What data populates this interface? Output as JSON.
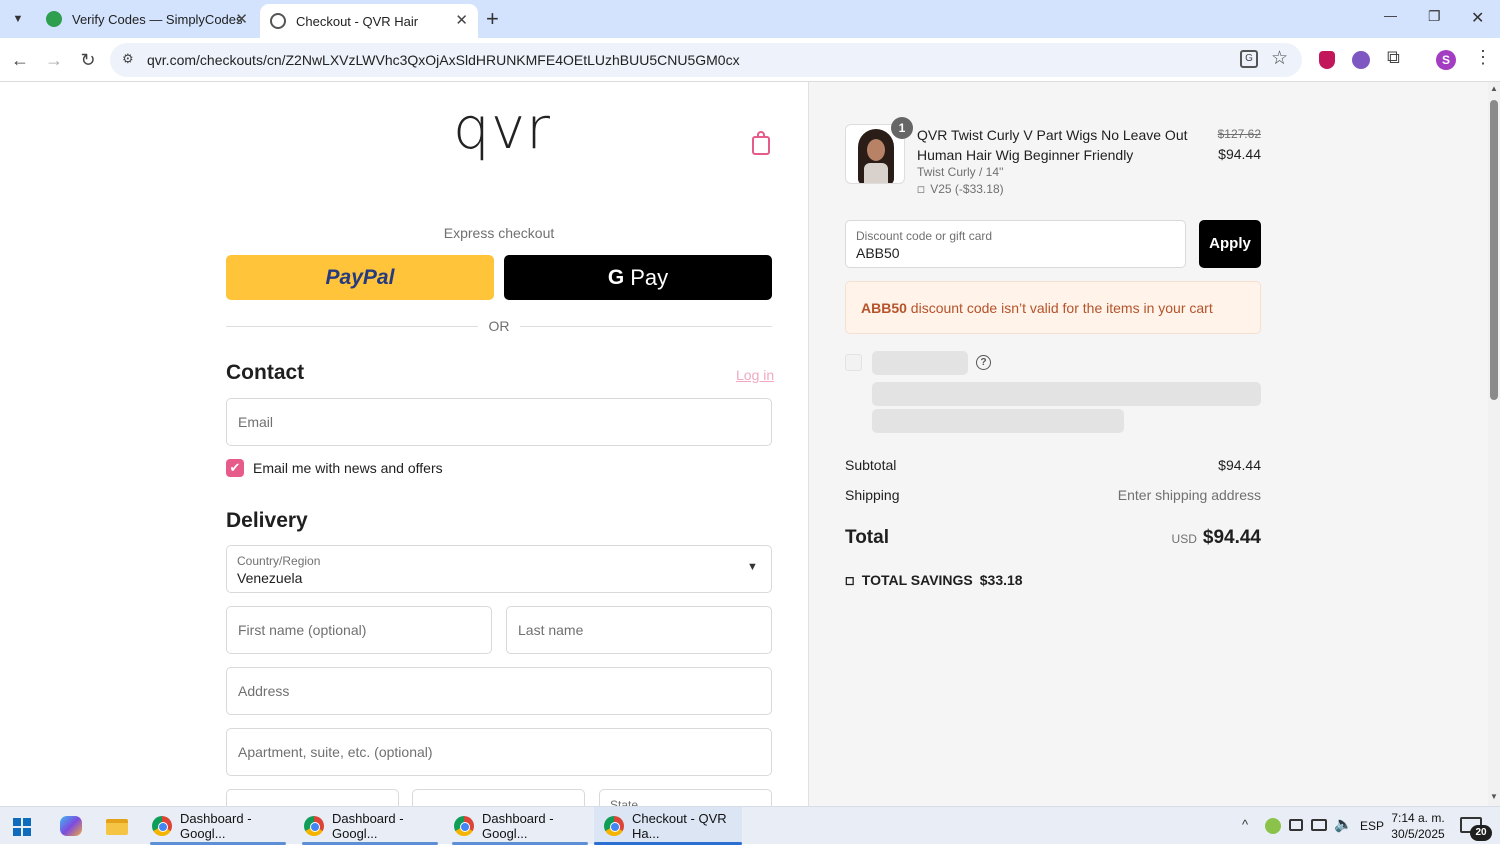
{
  "browser": {
    "tabs": [
      {
        "title": "Verify Codes — SimplyCodes",
        "close": "✕"
      },
      {
        "title": "Checkout - QVR Hair",
        "close": "✕"
      }
    ],
    "new_tab": "+",
    "url": "qvr.com/checkouts/cn/Z2NwLXVzLWVhc3QxOjAxSldHRUNKMFE4OEtLUzhBUU5CNU5GM0cx",
    "profile_initial": "S",
    "window_controls": {
      "minimize": "—",
      "restore": "❐",
      "close": "✕"
    }
  },
  "header": {
    "logo": "qvr"
  },
  "express": {
    "label": "Express checkout",
    "paypal": "PayPal",
    "gpay": "Pay",
    "or": "OR"
  },
  "contact": {
    "title": "Contact",
    "login": "Log in",
    "email_placeholder": "Email",
    "newsletter_label": "Email me with news and offers",
    "newsletter_checked": true
  },
  "delivery": {
    "title": "Delivery",
    "country_label": "Country/Region",
    "country_value": "Venezuela",
    "first_name_placeholder": "First name (optional)",
    "last_name_placeholder": "Last name",
    "address_placeholder": "Address",
    "apartment_placeholder": "Apartment, suite, etc. (optional)",
    "state_label": "State"
  },
  "order": {
    "item": {
      "quantity": "1",
      "name": "QVR Twist Curly V Part Wigs No Leave Out Human Hair Wig Beginner Friendly",
      "variant": "Twist Curly / 14''",
      "discount": "V25 (-$33.18)",
      "original_price": "$127.62",
      "price": "$94.44"
    },
    "discount_field": {
      "label": "Discount code or gift card",
      "value": "ABB50"
    },
    "apply": "Apply",
    "error": {
      "code": "ABB50",
      "message": " discount code isn’t valid for the items in your cart"
    },
    "help_icon": "?",
    "subtotal_label": "Subtotal",
    "subtotal_value": "$94.44",
    "shipping_label": "Shipping",
    "shipping_value": "Enter shipping address",
    "total_label": "Total",
    "total_currency": "USD",
    "total_value": "$94.44",
    "savings_label": "TOTAL SAVINGS",
    "savings_value": "$33.18"
  },
  "taskbar": {
    "apps": [
      {
        "label": "Dashboard - Googl..."
      },
      {
        "label": "Dashboard - Googl..."
      },
      {
        "label": "Dashboard - Googl..."
      },
      {
        "label": "Checkout - QVR Ha..."
      }
    ],
    "lang": "ESP",
    "time": "7:14 a. m.",
    "date": "30/5/2025",
    "notifications": "20"
  },
  "colors": {
    "accent_pink": "#e75b8a",
    "paypal_yellow": "#ffc439",
    "error_bg": "#fff3ea",
    "error_text": "#b5532a"
  }
}
